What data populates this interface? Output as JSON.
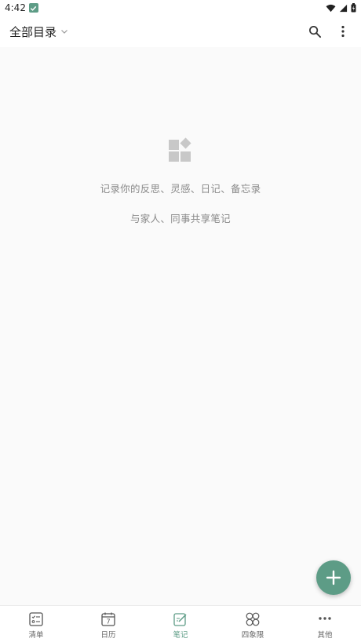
{
  "status_bar": {
    "time": "4:42"
  },
  "header": {
    "title": "全部目录"
  },
  "empty_state": {
    "line1": "记录你的反思、灵感、日记、备忘录",
    "line2": "与家人、同事共享笔记"
  },
  "bottom_nav": {
    "items": [
      {
        "label": "清单",
        "icon": "checklist-icon"
      },
      {
        "label": "日历",
        "icon": "calendar-icon",
        "icon_text": "7"
      },
      {
        "label": "笔记",
        "icon": "note-edit-icon",
        "active": true
      },
      {
        "label": "四象限",
        "icon": "four-quadrant-icon"
      },
      {
        "label": "其他",
        "icon": "more-horizontal-icon"
      }
    ]
  },
  "colors": {
    "accent": "#5d9c86",
    "text_secondary": "#8a8a8a",
    "icon_gray": "#c8c8c8"
  }
}
